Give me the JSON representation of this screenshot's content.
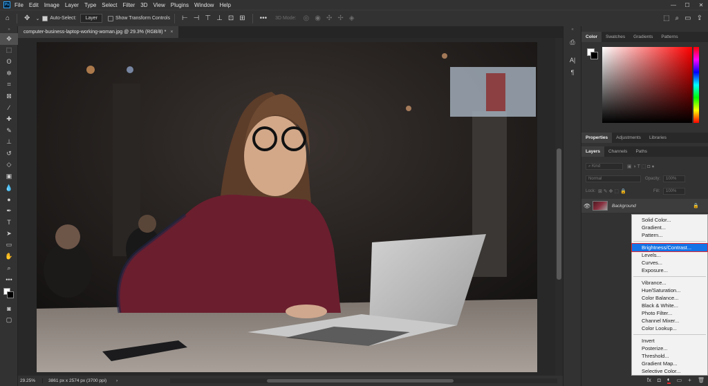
{
  "app": {
    "logo": "Ps"
  },
  "menubar": {
    "items": [
      "File",
      "Edit",
      "Image",
      "Layer",
      "Type",
      "Select",
      "Filter",
      "3D",
      "View",
      "Plugins",
      "Window",
      "Help"
    ],
    "window_controls": [
      "—",
      "☐",
      "✕"
    ]
  },
  "options": {
    "auto_select_label": "Auto-Select:",
    "auto_select_value": "Layer",
    "transform_label": "Show Transform Controls",
    "mode_3d_label": "3D Mode:"
  },
  "document": {
    "tab_title": "computer-business-laptop-working-woman.jpg @ 29.3% (RGB/8) *",
    "close_glyph": "×"
  },
  "status": {
    "zoom": "29.25%",
    "info": "3861 px x 2574 px (3700 ppi)",
    "arrow": "›"
  },
  "panels": {
    "color_tabs": [
      "Color",
      "Swatches",
      "Gradients",
      "Patterns"
    ],
    "props_tabs": [
      "Properties",
      "Adjustments",
      "Libraries"
    ],
    "layer_tabs": [
      "Layers",
      "Channels",
      "Paths"
    ],
    "kind_label": "Kind",
    "blend_mode": "Normal",
    "opacity_label": "Opacity:",
    "opacity_value": "100%",
    "lock_label": "Lock:",
    "fill_label": "Fill:",
    "fill_value": "100%",
    "layer_name": "Background",
    "bottom_icons": [
      "fx",
      "◘",
      "◐",
      "▭",
      "+",
      "🗑"
    ]
  },
  "adjustment_menu": {
    "group1": [
      "Solid Color...",
      "Gradient...",
      "Pattern..."
    ],
    "group2": [
      "Brightness/Contrast...",
      "Levels...",
      "Curves...",
      "Exposure..."
    ],
    "group3": [
      "Vibrance...",
      "Hue/Saturation...",
      "Color Balance...",
      "Black & White...",
      "Photo Filter...",
      "Channel Mixer...",
      "Color Lookup..."
    ],
    "group4": [
      "Invert",
      "Posterize...",
      "Threshold...",
      "Gradient Map...",
      "Selective Color..."
    ],
    "highlighted": "Brightness/Contrast...",
    "highlight_color": "#1473e6",
    "outline_color": "#e8242b"
  }
}
